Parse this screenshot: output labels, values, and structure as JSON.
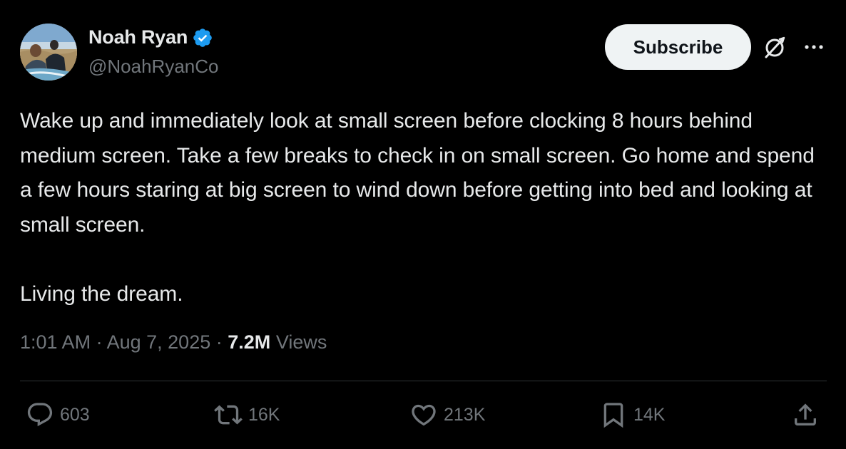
{
  "author": {
    "display_name": "Noah Ryan",
    "handle": "@NoahRyanCo",
    "verified": true,
    "verified_color": "#1d9bf0"
  },
  "header": {
    "subscribe_label": "Subscribe",
    "grok_icon": "grok-icon",
    "more_icon": "more-icon"
  },
  "tweet": {
    "paragraphs": [
      "Wake up and immediately look at small screen before clocking 8 hours behind medium screen. Take a few breaks to check in on small screen. Go home and spend a few hours staring at big screen to wind down before getting into bed and looking at small screen.",
      "Living the dream."
    ]
  },
  "meta": {
    "time": "1:01 AM",
    "date": "Aug 7, 2025",
    "views_count": "7.2M",
    "views_label": "Views",
    "separator": "·"
  },
  "actions": {
    "replies": "603",
    "reposts": "16K",
    "likes": "213K",
    "bookmarks": "14K"
  }
}
